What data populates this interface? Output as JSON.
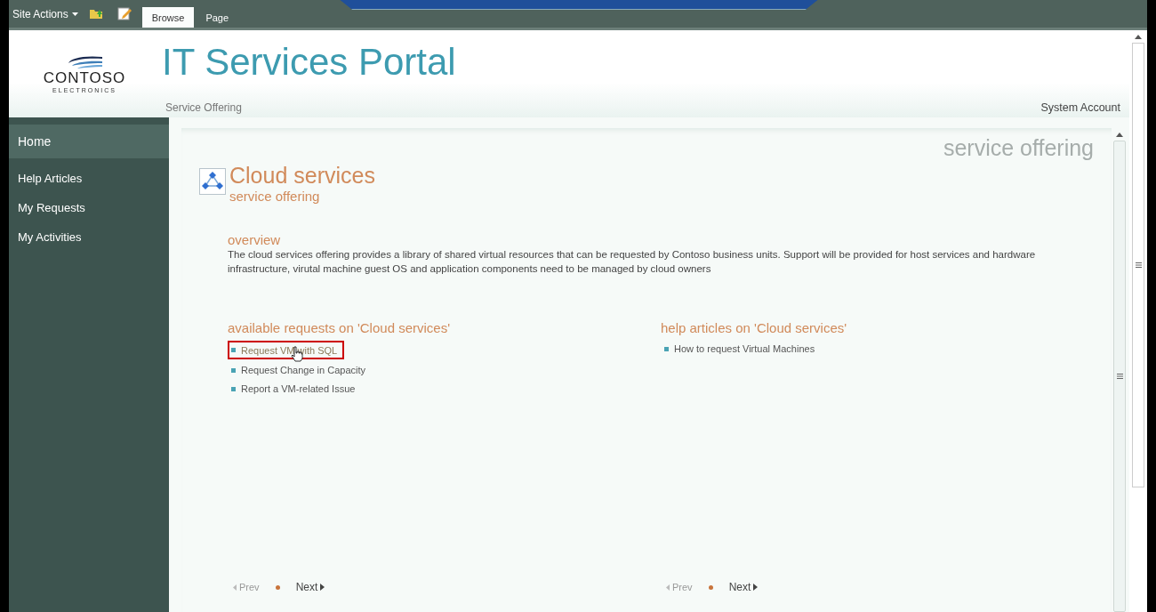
{
  "ribbon": {
    "site_actions": "Site Actions",
    "tabs": [
      {
        "label": "Browse",
        "selected": true
      },
      {
        "label": "Page",
        "selected": false
      }
    ]
  },
  "header": {
    "logo": {
      "name": "CONTOSO",
      "tagline": "ELECTRONICS"
    },
    "title": "IT Services Portal",
    "breadcrumb": "Service Offering",
    "user": "System Account"
  },
  "sidebar": {
    "items": [
      {
        "label": "Home",
        "selected": true
      },
      {
        "label": "Help Articles",
        "selected": false
      },
      {
        "label": "My Requests",
        "selected": false
      },
      {
        "label": "My Activities",
        "selected": false
      }
    ]
  },
  "content": {
    "page_label": "service offering",
    "title": "Cloud services",
    "subtitle": "service offering",
    "overview": {
      "heading": "overview",
      "text": "The cloud services offering provides a library of shared virtual resources that can be requested by Contoso business units.  Support will be provided for host services and hardware infrastructure, virutal machine guest OS and application components need to be managed by cloud owners"
    },
    "sections": [
      {
        "heading": "available requests on 'Cloud services'",
        "items": [
          {
            "label": "Request VM with SQL",
            "highlighted": true
          },
          {
            "label": "Request Change in Capacity",
            "highlighted": false
          },
          {
            "label": "Report a VM-related Issue",
            "highlighted": false
          }
        ],
        "pager": {
          "prev": "Prev",
          "next": "Next"
        }
      },
      {
        "heading": "help articles on 'Cloud services'",
        "items": [
          {
            "label": "How to request Virtual Machines",
            "highlighted": false
          }
        ],
        "pager": {
          "prev": "Prev",
          "next": "Next"
        }
      }
    ]
  }
}
